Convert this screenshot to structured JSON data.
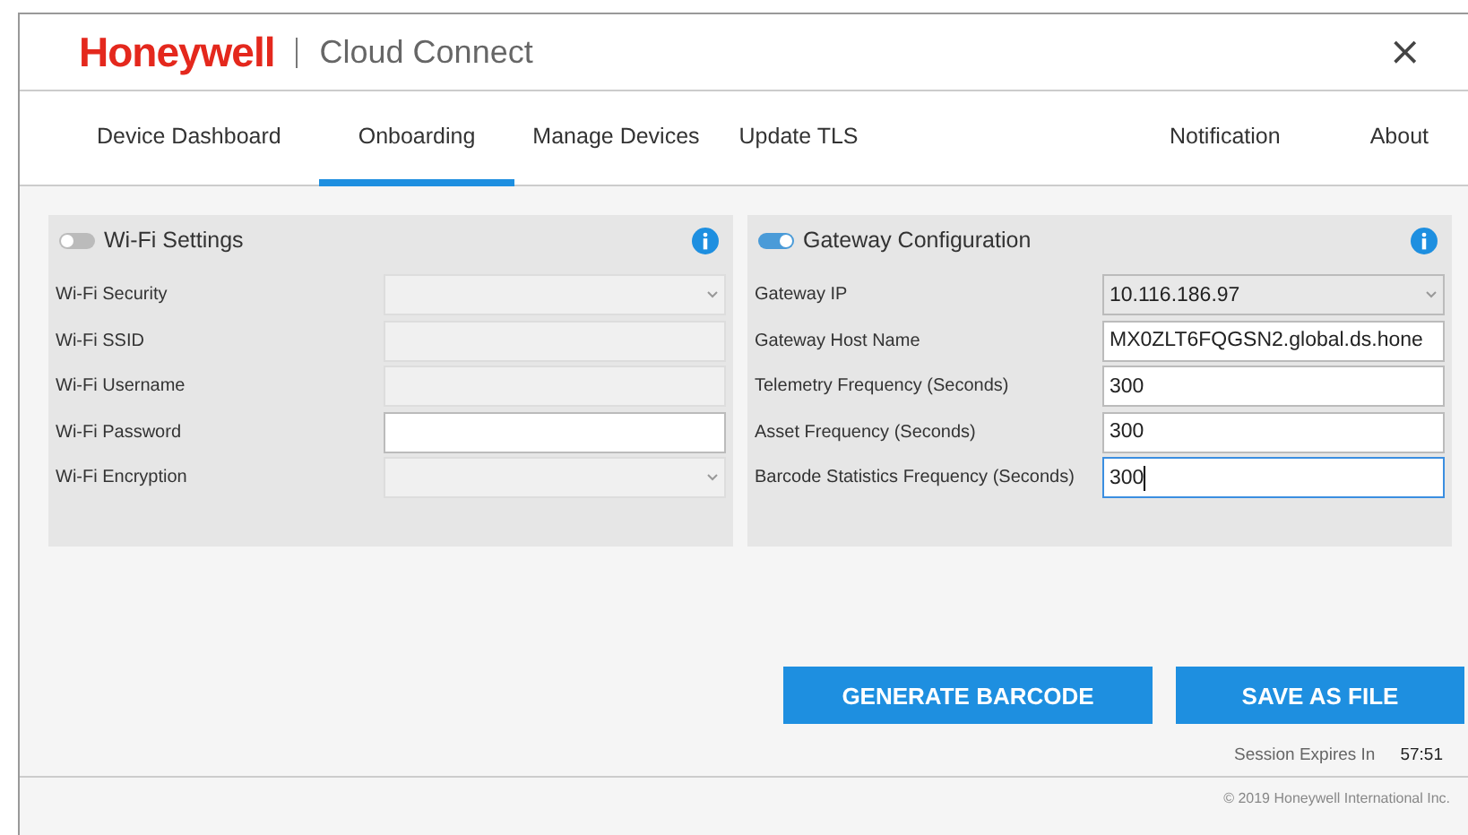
{
  "header": {
    "brand": "Honeywell",
    "title": "Cloud Connect",
    "close": "×"
  },
  "tabs": [
    {
      "label": "Device Dashboard",
      "selected": false
    },
    {
      "label": "Onboarding",
      "selected": true
    },
    {
      "label": "Manage Devices",
      "selected": false
    },
    {
      "label": "Update TLS",
      "selected": false
    },
    {
      "label": "Notification",
      "selected": false
    },
    {
      "label": "About",
      "selected": false
    }
  ],
  "panels": [
    {
      "title": "Wi-Fi Settings",
      "on": false,
      "fields": [
        {
          "label": "Wi-Fi Security",
          "kind": "select",
          "disabled": true,
          "focused": false
        },
        {
          "label": "Wi-Fi SSID",
          "kind": "text",
          "disabled": true,
          "focused": false
        },
        {
          "label": "Wi-Fi Username",
          "kind": "text",
          "disabled": true,
          "focused": false
        },
        {
          "label": "Wi-Fi Password",
          "kind": "text",
          "disabled": false,
          "focused": false
        },
        {
          "label": "Wi-Fi Encryption",
          "kind": "select",
          "disabled": true,
          "focused": false
        }
      ]
    },
    {
      "title": "Gateway Configuration",
      "on": true,
      "fields": [
        {
          "label": "Gateway IP",
          "kind": "select",
          "value": "10.116.186.97",
          "disabled": false,
          "focused": false
        },
        {
          "label": "Gateway Host Name",
          "kind": "text",
          "value": "MX0ZLT6FQGSN2.global.ds.hone",
          "disabled": false,
          "focused": false
        },
        {
          "label": "Telemetry Frequency (Seconds)",
          "kind": "text",
          "value": "300",
          "disabled": false,
          "focused": false
        },
        {
          "label": "Asset Frequency (Seconds)",
          "kind": "text",
          "value": "300",
          "disabled": false,
          "focused": false
        },
        {
          "label": "Barcode Statistics Frequency (Seconds)",
          "kind": "text",
          "value": "300",
          "disabled": false,
          "focused": true
        }
      ]
    }
  ],
  "buttons": [
    "GENERATE BARCODE",
    "SAVE AS FILE"
  ],
  "session": {
    "label": "Session Expires In",
    "time": "57:51"
  },
  "footer": "© 2019 Honeywell International Inc."
}
